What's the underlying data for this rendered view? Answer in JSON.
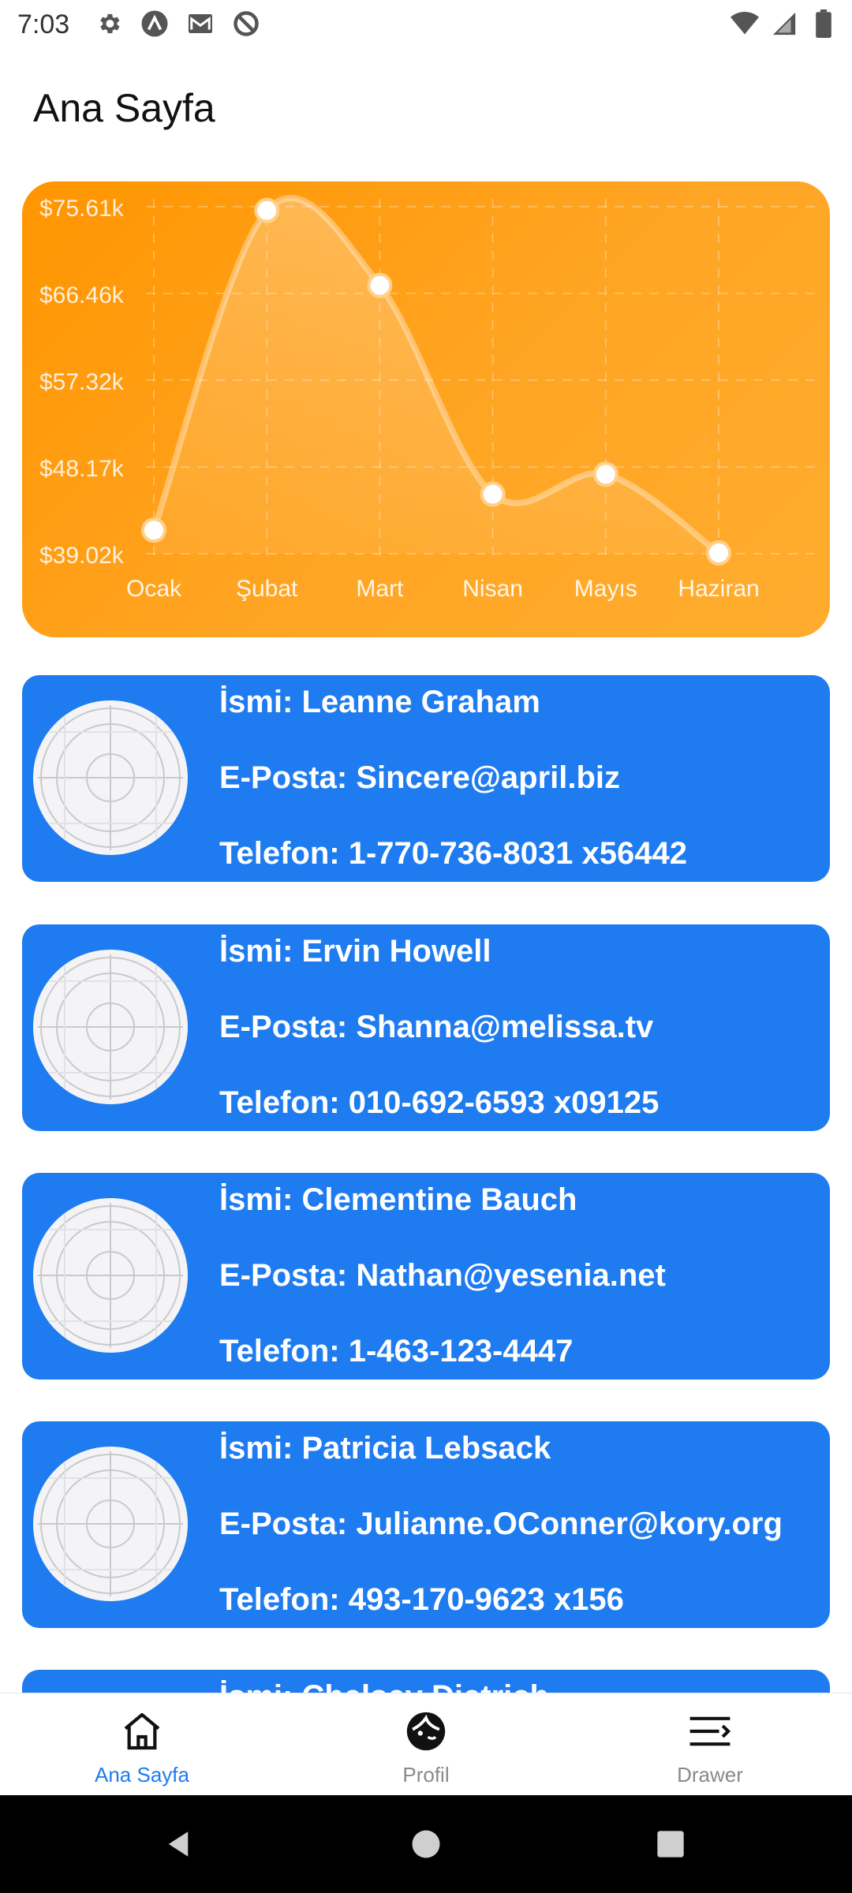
{
  "status_bar": {
    "time": "7:03",
    "left_icons": [
      "gear-icon",
      "a-logo-icon",
      "gmail-icon",
      "no-sync-icon"
    ],
    "right_icons": [
      "wifi-icon",
      "signal-icon",
      "battery-icon"
    ]
  },
  "header": {
    "title": "Ana Sayfa"
  },
  "chart_data": {
    "type": "area",
    "categories": [
      "Ocak",
      "Şubat",
      "Mart",
      "Nisan",
      "Mayıs",
      "Haziran"
    ],
    "values": [
      41500,
      75200,
      67300,
      45300,
      47400,
      39100
    ],
    "yticks": [
      "$75.61k",
      "$66.46k",
      "$57.32k",
      "$48.17k",
      "$39.02k"
    ],
    "ylim": [
      39020,
      75610
    ],
    "grid": true,
    "title": "",
    "xlabel": "",
    "ylabel": ""
  },
  "users": [
    {
      "name": "İsmi: Leanne Graham",
      "email": "E-Posta: Sincere@april.biz",
      "phone": "Telefon: 1-770-736-8031 x56442"
    },
    {
      "name": "İsmi: Ervin Howell",
      "email": "E-Posta: Shanna@melissa.tv",
      "phone": "Telefon: 010-692-6593 x09125"
    },
    {
      "name": "İsmi: Clementine Bauch",
      "email": "E-Posta: Nathan@yesenia.net",
      "phone": "Telefon: 1-463-123-4447"
    },
    {
      "name": "İsmi: Patricia Lebsack",
      "email": "E-Posta: Julianne.OConner@kory.org",
      "phone": "Telefon: 493-170-9623 x156"
    },
    {
      "name": "İsmi: Chelsey Dietrich",
      "email": "",
      "phone": ""
    }
  ],
  "bottom_nav": {
    "items": [
      {
        "label": "Ana Sayfa",
        "icon": "home-icon",
        "active": true
      },
      {
        "label": "Profil",
        "icon": "profile-icon",
        "active": false
      },
      {
        "label": "Drawer",
        "icon": "drawer-menu-icon",
        "active": false
      }
    ]
  },
  "colors": {
    "accent": "#1e7bf0",
    "chart_bg": "#ff9f1a",
    "card_bg": "#1e7bf0"
  }
}
